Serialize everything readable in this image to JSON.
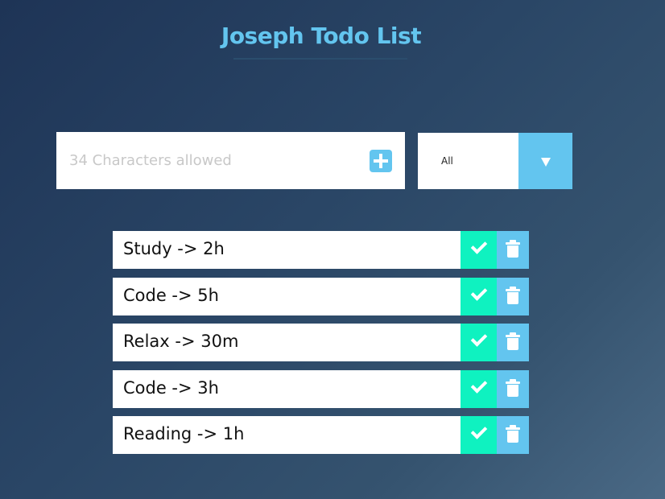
{
  "header": {
    "title": "Joseph Todo List"
  },
  "form": {
    "input_value": "",
    "input_placeholder": "34 Characters allowed",
    "add_icon": "plus-square-icon",
    "filter": {
      "selected": "All",
      "arrow_icon": "caret-down-icon"
    }
  },
  "todos": [
    {
      "text": "Study -> 2h"
    },
    {
      "text": "Code -> 5h"
    },
    {
      "text": "Relax -> 30m"
    },
    {
      "text": "Code -> 3h"
    },
    {
      "text": "Reading -> 1h"
    }
  ],
  "item_actions": {
    "complete_icon": "check-icon",
    "delete_icon": "trash-icon"
  },
  "colors": {
    "accent": "#63c5ef",
    "complete": "#0ff2c0",
    "background_start": "#1e3456",
    "background_end": "#4a6985"
  }
}
